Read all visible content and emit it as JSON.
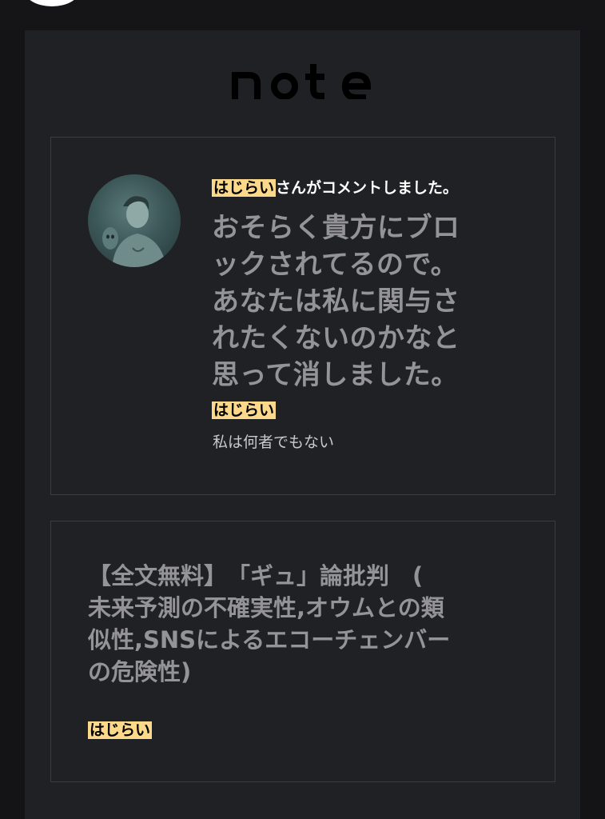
{
  "logo": {
    "text": "note"
  },
  "comment_card": {
    "user_name": "はじらい",
    "notification_suffix": "さんがコメントしました。",
    "comment_lines": [
      "おそらく貴方にブロ",
      "ックされてるので。",
      "あなたは私に関与さ",
      "れたくないのかなと",
      "思って消しました。"
    ],
    "author_name": "はじらい",
    "author_bio": "私は何者でもない"
  },
  "article_card": {
    "title_lines": [
      "【全文無料】　「ギュ」論批判　(",
      "未来予測の不確実性,オウムとの類",
      "似性,SNSによるエコーチェンバー",
      "の危険性)"
    ],
    "author_name": "はじらい"
  },
  "colors": {
    "highlight": "#fbd88a",
    "panel": "#202124",
    "muted_text": "#949498"
  }
}
